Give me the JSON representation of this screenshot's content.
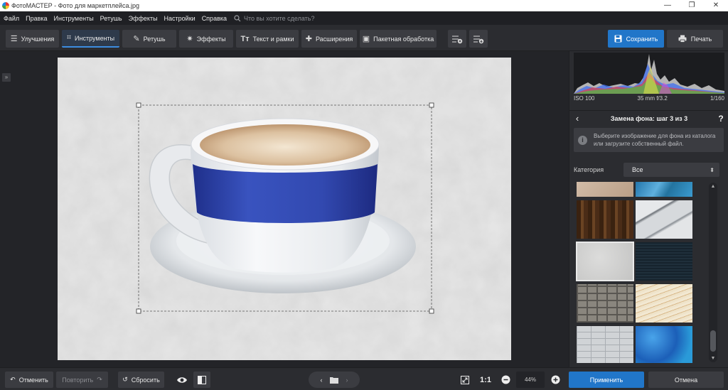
{
  "window": {
    "title": "ФотоМАСТЕР - Фото для маркетплейса.jpg",
    "minimize_icon": "—",
    "maximize_icon": "❐",
    "close_icon": "✕"
  },
  "menu": {
    "items": [
      "Файл",
      "Правка",
      "Инструменты",
      "Ретушь",
      "Эффекты",
      "Настройки",
      "Справка"
    ],
    "search_placeholder": "Что вы хотите сделать?"
  },
  "toolbar": {
    "tabs": [
      {
        "label": "Улучшения",
        "icon": "sliders-icon",
        "glyph": "☰",
        "active": false
      },
      {
        "label": "Инструменты",
        "icon": "crop-icon",
        "glyph": "⌗",
        "active": true
      },
      {
        "label": "Ретушь",
        "icon": "brush-icon",
        "glyph": "✎",
        "active": false
      },
      {
        "label": "Эффекты",
        "icon": "magic-wand-icon",
        "glyph": "✷",
        "active": false
      },
      {
        "label": "Текст и рамки",
        "icon": "text-icon",
        "glyph": "Tт",
        "active": false
      },
      {
        "label": "Расширения",
        "icon": "plus-icon",
        "glyph": "✚",
        "active": false
      },
      {
        "label": "Пакетная обработка",
        "icon": "batch-icon",
        "glyph": "▣",
        "active": false
      }
    ],
    "save_label": "Сохранить",
    "print_label": "Печать"
  },
  "histogram": {
    "iso": "ISO 100",
    "lens": "35 mm f/3.2",
    "shutter": "1/160"
  },
  "panel": {
    "step_title": "Замена фона: шаг 3 из 3",
    "help": "?",
    "hint_line1": "Выберите изображение для фона из каталога",
    "hint_line2": "или загрузите собственный файл.",
    "category_label": "Категория",
    "category_value": "Все",
    "thumbnails": [
      {
        "name": "beige-plaster",
        "color": "#c9b29e",
        "selected": false
      },
      {
        "name": "blue-marble",
        "color": "#2b7fb4",
        "selected": false
      },
      {
        "name": "dark-wood",
        "color": "#4a2c17",
        "selected": false
      },
      {
        "name": "white-marble",
        "color": "#cfd2d5",
        "selected": false
      },
      {
        "name": "grey-plaster",
        "color": "#cfcfce",
        "selected": true
      },
      {
        "name": "dark-teal",
        "color": "#1c2a35",
        "selected": false
      },
      {
        "name": "stone-wall",
        "color": "#6f6c66",
        "selected": false
      },
      {
        "name": "gold-waves",
        "color": "#e9dcc0",
        "selected": false
      },
      {
        "name": "white-brick",
        "color": "#c9ccd0",
        "selected": false
      },
      {
        "name": "blue-paint",
        "color": "#2a7bd0",
        "selected": false
      }
    ]
  },
  "bottom": {
    "undo_label": "Отменить",
    "redo_label": "Повторить",
    "reset_label": "Сбросить",
    "zoom": "44%",
    "one_to_one": "1:1",
    "apply_label": "Применить",
    "cancel_label": "Отмена"
  },
  "colors": {
    "accent": "#2176c9",
    "panel": "#2b2c30",
    "button": "#3b3c41",
    "canvas": "#232428"
  }
}
